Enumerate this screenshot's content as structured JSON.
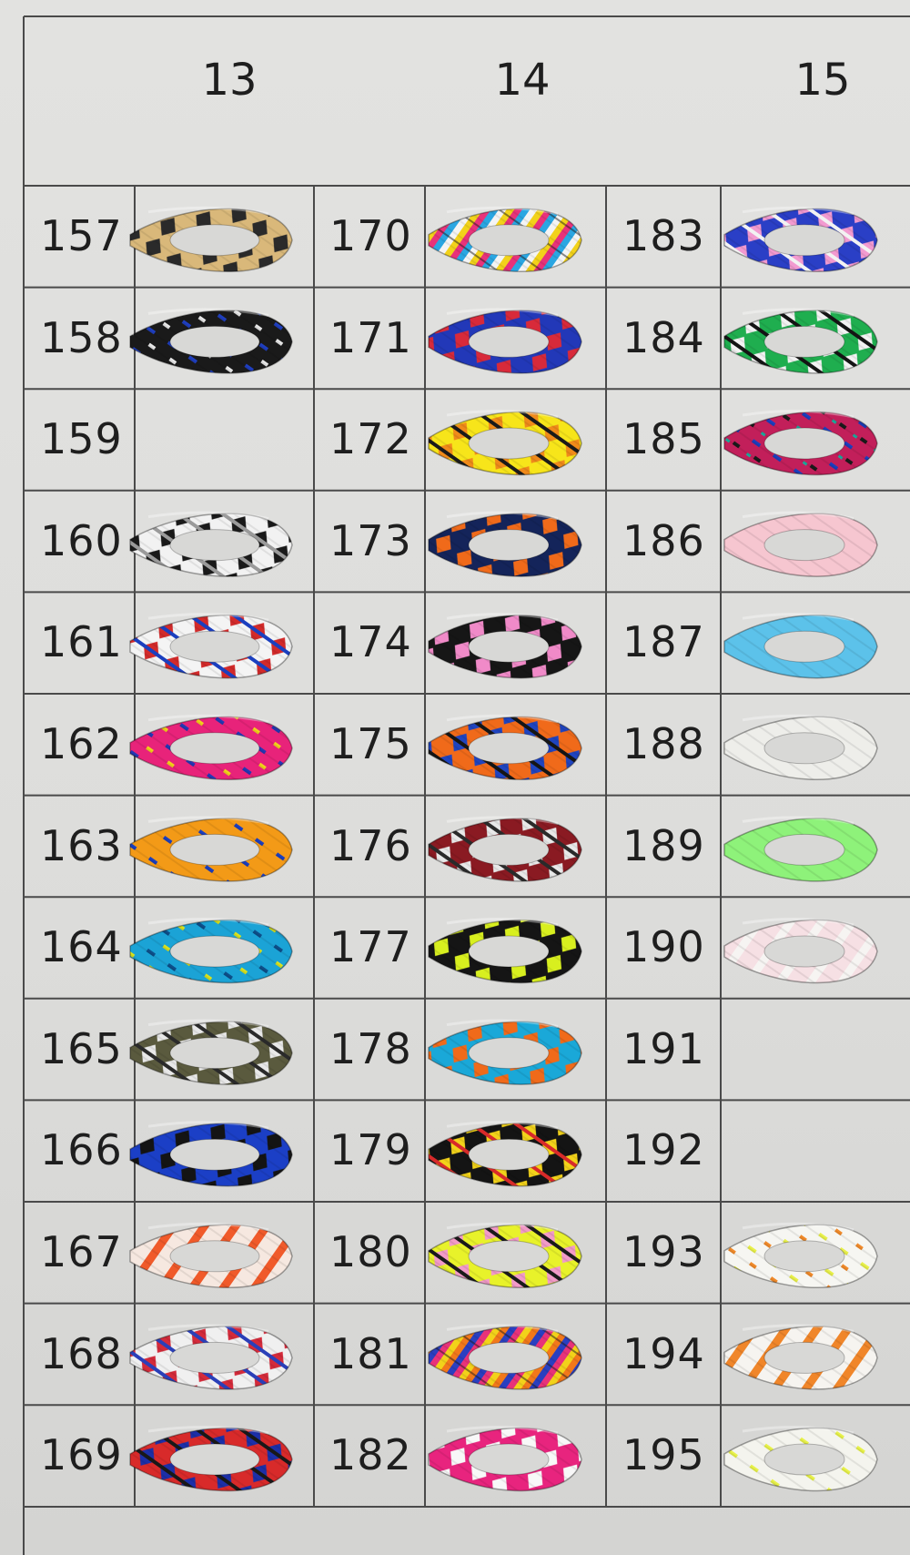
{
  "column_headers": [
    "13",
    "14",
    "15"
  ],
  "columns": [
    {
      "header": "13",
      "items": [
        {
          "number": "157",
          "colors": [
            "#d9b87a",
            "#2a2a2a"
          ],
          "pattern": "diamond"
        },
        {
          "number": "158",
          "colors": [
            "#1a1a1a",
            "#1f3fc0",
            "#e8e8e8"
          ],
          "pattern": "fleck"
        },
        {
          "number": "159",
          "colors": [],
          "pattern": "none"
        },
        {
          "number": "160",
          "colors": [
            "#f2f2f2",
            "#1a1a1a",
            "#9a9a9a"
          ],
          "pattern": "camo"
        },
        {
          "number": "161",
          "colors": [
            "#f4f4f4",
            "#d32a2a",
            "#1b3fbf"
          ],
          "pattern": "diamond"
        },
        {
          "number": "162",
          "colors": [
            "#e8237a",
            "#2438b5",
            "#f2d21a"
          ],
          "pattern": "fleck"
        },
        {
          "number": "163",
          "colors": [
            "#f39a17",
            "#1b3fbf"
          ],
          "pattern": "fleck"
        },
        {
          "number": "164",
          "colors": [
            "#1ba3d6",
            "#0d4f8a",
            "#d9e21f"
          ],
          "pattern": "fleck"
        },
        {
          "number": "165",
          "colors": [
            "#5a5a3e",
            "#e8e8e8",
            "#2a2a2a"
          ],
          "pattern": "camo"
        },
        {
          "number": "166",
          "colors": [
            "#1b3fc6",
            "#141414"
          ],
          "pattern": "diamond"
        },
        {
          "number": "167",
          "colors": [
            "#f6e8e0",
            "#f05a2a"
          ],
          "pattern": "stripe"
        },
        {
          "number": "168",
          "colors": [
            "#f0f0f0",
            "#d42a3a",
            "#2a3fb8"
          ],
          "pattern": "diamond"
        },
        {
          "number": "169",
          "colors": [
            "#d82a2a",
            "#1c2fa8",
            "#181818"
          ],
          "pattern": "diamond"
        }
      ]
    },
    {
      "header": "14",
      "items": [
        {
          "number": "170",
          "colors": [
            "#f2d21a",
            "#e8327a",
            "#2aa6e2",
            "#f4f4f4"
          ],
          "pattern": "rainbow"
        },
        {
          "number": "171",
          "colors": [
            "#2238b8",
            "#d82a3a"
          ],
          "pattern": "diamond"
        },
        {
          "number": "172",
          "colors": [
            "#f7e51a",
            "#f08a1a",
            "#1a1a1a"
          ],
          "pattern": "diamond"
        },
        {
          "number": "173",
          "colors": [
            "#14245a",
            "#f06a1a"
          ],
          "pattern": "diamond"
        },
        {
          "number": "174",
          "colors": [
            "#161616",
            "#f08ac8"
          ],
          "pattern": "diamond"
        },
        {
          "number": "175",
          "colors": [
            "#f06a1a",
            "#1f44c0",
            "#151515"
          ],
          "pattern": "diamond"
        },
        {
          "number": "176",
          "colors": [
            "#8a1a22",
            "#e8e8e8",
            "#2a2a2a"
          ],
          "pattern": "camo"
        },
        {
          "number": "177",
          "colors": [
            "#151515",
            "#d8ef1f"
          ],
          "pattern": "diamond"
        },
        {
          "number": "178",
          "colors": [
            "#1aa8d8",
            "#f06a1a"
          ],
          "pattern": "diamond"
        },
        {
          "number": "179",
          "colors": [
            "#141414",
            "#f2d21a",
            "#d82a2a",
            "#1f44c0"
          ],
          "pattern": "diamond"
        },
        {
          "number": "180",
          "colors": [
            "#e8f22a",
            "#f29ac8",
            "#1a1a1a"
          ],
          "pattern": "diamond"
        },
        {
          "number": "181",
          "colors": [
            "#f2781a",
            "#2a3fc0",
            "#e8327a",
            "#f2d21a"
          ],
          "pattern": "rainbow"
        },
        {
          "number": "182",
          "colors": [
            "#e8247e",
            "#f8f8f8"
          ],
          "pattern": "diamond"
        }
      ]
    },
    {
      "header": "15",
      "items": [
        {
          "number": "183",
          "colors": [
            "#2a3fc6",
            "#f29ad0",
            "#f2f2f2"
          ],
          "pattern": "diamond"
        },
        {
          "number": "184",
          "colors": [
            "#1fae4f",
            "#f2f2f2",
            "#141414"
          ],
          "pattern": "diamond"
        },
        {
          "number": "185",
          "colors": [
            "#c21f5a",
            "#1b3fbf",
            "#1a1a1a",
            "#1ab0a0"
          ],
          "pattern": "fleck"
        },
        {
          "number": "186",
          "colors": [
            "#f6c6d0"
          ],
          "pattern": "solid"
        },
        {
          "number": "187",
          "colors": [
            "#5cc2ea"
          ],
          "pattern": "solid"
        },
        {
          "number": "188",
          "colors": [
            "#eeeeea"
          ],
          "pattern": "solid"
        },
        {
          "number": "189",
          "colors": [
            "#8ef27a"
          ],
          "pattern": "solid"
        },
        {
          "number": "190",
          "colors": [
            "#f6e0e4",
            "#f6f4f2"
          ],
          "pattern": "stripe"
        },
        {
          "number": "191",
          "colors": [],
          "pattern": "none"
        },
        {
          "number": "192",
          "colors": [],
          "pattern": "none"
        },
        {
          "number": "193",
          "colors": [
            "#f6f6f2",
            "#e8f04a",
            "#f08a2a"
          ],
          "pattern": "fleck"
        },
        {
          "number": "194",
          "colors": [
            "#f6f4f0",
            "#f0862a"
          ],
          "pattern": "stripe"
        },
        {
          "number": "195",
          "colors": [
            "#f4f4ee",
            "#e8f24a"
          ],
          "pattern": "fleck"
        }
      ]
    }
  ]
}
